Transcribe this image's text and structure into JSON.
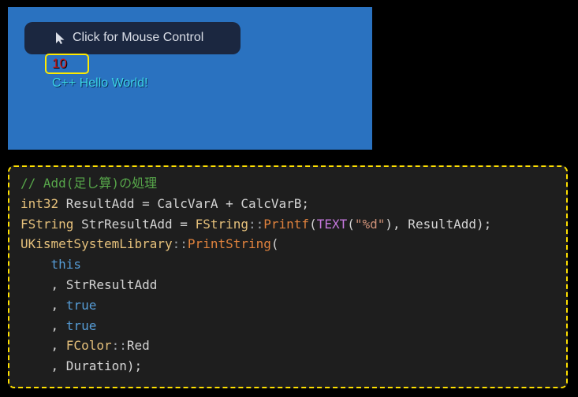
{
  "viewport": {
    "mouse_button": {
      "label": "Click for Mouse Control",
      "icon": "cursor-icon"
    },
    "value": "10",
    "hello": "C++ Hello World!",
    "colors": {
      "background": "#2a72c0",
      "value": "#c91818",
      "hello": "#3bd4e6",
      "highlight": "#ffeb00"
    }
  },
  "code": {
    "colors": {
      "comment": "#57a64a",
      "type": "#e5c07b",
      "plain": "#d4d4d4",
      "keyword": "#569cd6",
      "function": "#e0823d",
      "macro": "#c678dd",
      "string": "#ce9178",
      "punct": "#d4d4d4",
      "scope": "#9aa0a6"
    },
    "lines": [
      [
        {
          "t": "// Add(足し算)の処理",
          "c": "comment"
        }
      ],
      [
        {
          "t": "int32",
          "c": "type"
        },
        {
          "t": " ResultAdd = CalcVarA + CalcVarB;",
          "c": "plain"
        }
      ],
      [
        {
          "t": "FString",
          "c": "type"
        },
        {
          "t": " StrResultAdd = ",
          "c": "plain"
        },
        {
          "t": "FString",
          "c": "type"
        },
        {
          "t": "::",
          "c": "scope"
        },
        {
          "t": "Printf",
          "c": "function"
        },
        {
          "t": "(",
          "c": "punct"
        },
        {
          "t": "TEXT",
          "c": "macro"
        },
        {
          "t": "(",
          "c": "punct"
        },
        {
          "t": "\"%d\"",
          "c": "string"
        },
        {
          "t": "), ResultAdd);",
          "c": "plain"
        }
      ],
      [
        {
          "t": "UKismetSystemLibrary",
          "c": "type"
        },
        {
          "t": "::",
          "c": "scope"
        },
        {
          "t": "PrintString",
          "c": "function"
        },
        {
          "t": "(",
          "c": "punct"
        }
      ],
      [
        {
          "t": "    ",
          "c": "plain"
        },
        {
          "t": "this",
          "c": "keyword"
        }
      ],
      [
        {
          "t": "    , StrResultAdd",
          "c": "plain"
        }
      ],
      [
        {
          "t": "    , ",
          "c": "plain"
        },
        {
          "t": "true",
          "c": "keyword"
        }
      ],
      [
        {
          "t": "    , ",
          "c": "plain"
        },
        {
          "t": "true",
          "c": "keyword"
        }
      ],
      [
        {
          "t": "    , ",
          "c": "plain"
        },
        {
          "t": "FColor",
          "c": "type"
        },
        {
          "t": "::",
          "c": "scope"
        },
        {
          "t": "Red",
          "c": "plain"
        }
      ],
      [
        {
          "t": "    , Duration);",
          "c": "plain"
        }
      ]
    ]
  }
}
